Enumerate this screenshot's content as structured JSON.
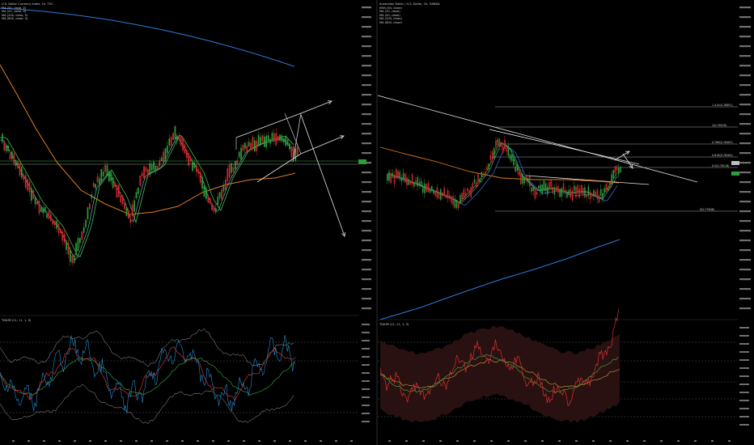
{
  "panels": [
    {
      "id": "dxy",
      "title": "U.S. Dollar Currency Index, 1h, TVC",
      "legend": [
        "MA (50, close, 0)",
        "MA (20, close, 0)",
        "MA (200, close, 0)",
        "MA (800, close, 0)"
      ],
      "indicator_title": "TDIUM (11, 11, 1, 9)"
    },
    {
      "id": "audusd",
      "title": "Australian Dollar / U.S. Dollar, 1h, OANDA",
      "legend": [
        "EMA (50, close)",
        "MA (20, close)",
        "MA (50, close)",
        "MA (200, close)",
        "MA (800, close)"
      ],
      "indicator_title": "TDIUM (11, 11, 1, 9)"
    }
  ],
  "fib_labels": [
    "1.414(0.76891)",
    "1(0.76518)",
    "0.786(0.76483)",
    "0.618(0.76264)",
    "0.5(0.76118)",
    "0(0.75848)"
  ],
  "colors": {
    "background": "#000000",
    "bull": "#2e9e3a",
    "bear": "#d02a2a",
    "ma_blue": "#2e7bd6",
    "ma_orange": "#e07d22",
    "ma_green": "#3fbf4f",
    "ma_light": "#79c7e0",
    "white": "#e6e6e6",
    "ind_blue": "#1f8fd0",
    "ind_red": "#d43030"
  },
  "chart_data": [
    {
      "type": "candlestick",
      "title": "U.S. Dollar Currency Index, 1h, TVC",
      "series": [
        {
          "name": "MA (200, close, 0)",
          "trend": "declining"
        },
        {
          "name": "MA (800, close, 0)",
          "trend": "rising"
        }
      ],
      "annotations": [
        "rising channel",
        "breakdown arrow",
        "breakout arrows"
      ]
    },
    {
      "type": "candlestick",
      "title": "Australian Dollar / U.S. Dollar, 1h, OANDA",
      "fib_levels": [
        1.414,
        1,
        0.786,
        0.618,
        0.5,
        0
      ],
      "fib_prices": [
        0.76891,
        0.76518,
        0.76483,
        0.76264,
        0.76118,
        0.75848
      ],
      "annotations": [
        "descending trendline",
        "triangle",
        "breakout arrow"
      ]
    }
  ]
}
